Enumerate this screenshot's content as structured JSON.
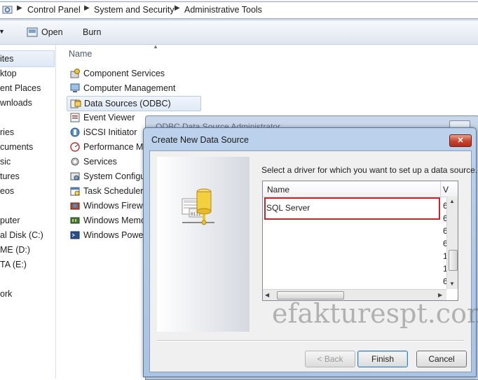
{
  "address_bar": {
    "crumbs": [
      "Control Panel",
      "System and Security",
      "Administrative Tools"
    ]
  },
  "toolbar": {
    "open_label": "Open",
    "burn_label": "Burn"
  },
  "nav_pane": {
    "items": [
      "ites",
      "ktop",
      "ent Places",
      "wnloads",
      "ries",
      "cuments",
      "sic",
      "tures",
      "eos",
      "puter",
      "al Disk (C:)",
      "ME (D:)",
      "TA (E:)",
      "ork"
    ]
  },
  "file_list": {
    "column_name": "Name",
    "items": [
      "Component Services",
      "Computer Management",
      "Data Sources (ODBC)",
      "Event Viewer",
      "iSCSI Initiator",
      "Performance Mo",
      "Services",
      "System Configu",
      "Task Scheduler",
      "Windows Firewa",
      "Windows Memo",
      "Windows Power"
    ],
    "selected_index": 2
  },
  "background_window": {
    "title": "ODBC Data Source Administrator"
  },
  "dialog": {
    "title": "Create New Data Source",
    "close_glyph": "✕",
    "prompt": "Select a driver for which you want to set up a data source.",
    "list": {
      "col_name": "Name",
      "col_version": "V",
      "selected_driver": "SQL Server",
      "version_fragments": [
        "6",
        "6",
        "6",
        "6",
        "1",
        "1",
        "6"
      ]
    },
    "watermark": "efakturespt.com",
    "buttons": {
      "back": "< Back",
      "finish": "Finish",
      "cancel": "Cancel"
    }
  },
  "colors": {
    "highlight_border": "#c7242c",
    "dialog_frame": "#a9c3e4"
  }
}
